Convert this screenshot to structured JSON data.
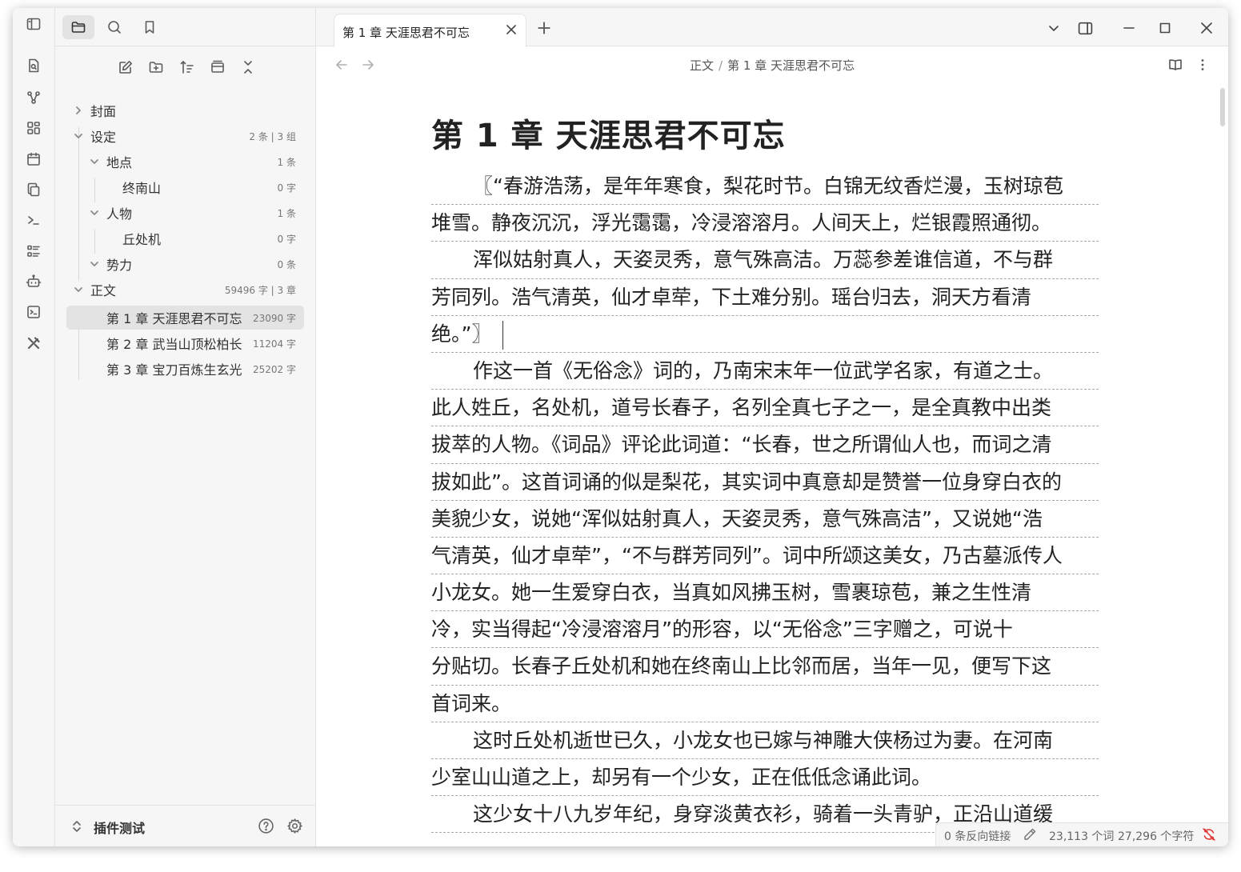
{
  "ribbon": {
    "icons": [
      "search-file-icon",
      "graph-icon",
      "canvas-icon",
      "calendar-icon",
      "copy-icon",
      "terminal-icon",
      "list-icon",
      "bot-icon",
      "console-icon",
      "tools-icon"
    ]
  },
  "sidebar": {
    "top_buttons": [
      "toggle-sidebar-icon",
      "folder-icon",
      "search-icon",
      "bookmark-icon"
    ],
    "nav_buttons": [
      "new-note-icon",
      "new-folder-icon",
      "sort-icon",
      "collapse-view-icon",
      "collapse-all-icon"
    ],
    "tree": [
      {
        "label": "封面",
        "meta": "",
        "expanded": false
      },
      {
        "label": "设定",
        "meta": "2 条 | 3 组",
        "expanded": true
      },
      {
        "label": "地点",
        "meta": "1 条",
        "expanded": true
      },
      {
        "label": "终南山",
        "meta": "0 字"
      },
      {
        "label": "人物",
        "meta": "1 条",
        "expanded": true
      },
      {
        "label": "丘处机",
        "meta": "0 字"
      },
      {
        "label": "势力",
        "meta": "0 条",
        "expanded": true
      },
      {
        "label": "正文",
        "meta": "59496 字 | 3 章",
        "expanded": true
      },
      {
        "label": "第 1 章 天涯思君不可忘",
        "meta": "23090 字",
        "selected": true
      },
      {
        "label": "第 2 章 武当山顶松柏长",
        "meta": "11204 字"
      },
      {
        "label": "第 3 章 宝刀百炼生玄光",
        "meta": "25202 字"
      }
    ],
    "vault_name": "插件测试"
  },
  "tab": {
    "title": "第 1 章 天涯思君不可忘"
  },
  "breadcrumb": {
    "parent": "正文",
    "separator": "/",
    "current": "第 1 章 天涯思君不可忘"
  },
  "document": {
    "title": "第 1 章 天涯思君不可忘",
    "lines": [
      "〖“春游浩荡，是年年寒食，梨花时节。白锦无纹香烂漫，玉树琼苞",
      "堆雪。静夜沉沉，浮光霭霭，冷浸溶溶月。人间天上，烂银霞照通彻。",
      "浑似姑射真人，天姿灵秀，意气殊高洁。万蕊参差谁信道，不与群",
      "芳同列。浩气清英，仙才卓荦，下土难分别。瑶台归去，洞天方看清",
      "绝。”〗",
      "作这一首《无俗念》词的，乃南宋末年一位武学名家，有道之士。",
      "此人姓丘，名处机，道号长春子，名列全真七子之一，是全真教中出类",
      "拔萃的人物。《词品》评论此词道：“长春，世之所谓仙人也，而词之清",
      "拔如此”。这首词诵的似是梨花，其实词中真意却是赞誉一位身穿白衣的",
      "美貌少女，说她“浑似姑射真人，天姿灵秀，意气殊高洁”，又说她“浩",
      "气清英，仙才卓荦”，“不与群芳同列”。词中所颂这美女，乃古墓派传人",
      "小龙女。她一生爱穿白衣，当真如风拂玉树，雪裹琼苞，兼之生性清",
      "冷，实当得起“冷浸溶溶月”的形容，以“无俗念”三字赠之，可说十",
      "分贴切。长春子丘处机和她在终南山上比邻而居，当年一见，便写下这",
      "首词来。",
      "这时丘处机逝世已久，小龙女也已嫁与神雕大侠杨过为妻。在河南",
      "少室山山道之上，却另有一个少女，正在低低念诵此词。",
      "这少女十八九岁年纪，身穿淡黄衣衫，骑着一头青驴，正沿山道缓"
    ]
  },
  "statusbar": {
    "backlinks": "0 条反向链接",
    "words": "23,113 个词",
    "chars": "27,296 个字符"
  }
}
